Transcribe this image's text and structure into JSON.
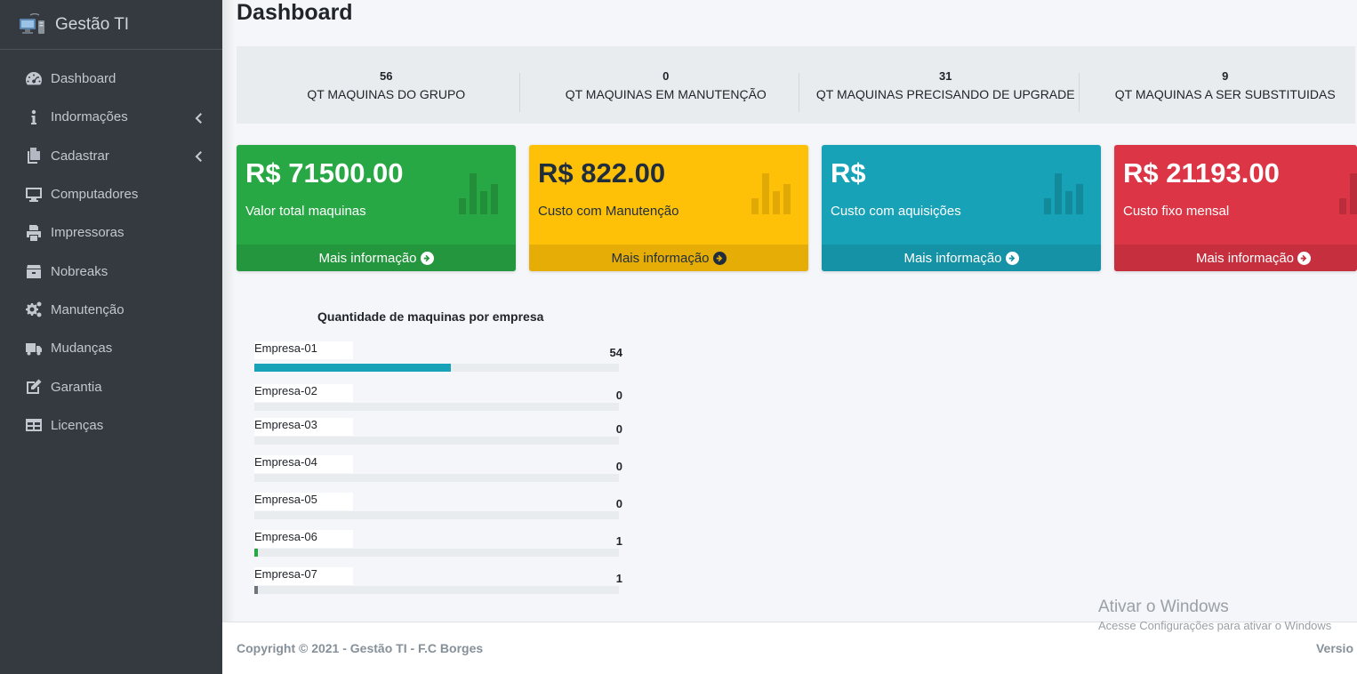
{
  "brand": {
    "name": "Gestão TI"
  },
  "sidebar": {
    "items": [
      {
        "label": "Dashboard",
        "icon": "tachometer-icon"
      },
      {
        "label": "Indormações",
        "icon": "info-icon",
        "has_submenu": true
      },
      {
        "label": "Cadastrar",
        "icon": "copy-icon",
        "has_submenu": true
      },
      {
        "label": "Computadores",
        "icon": "desktop-icon"
      },
      {
        "label": "Impressoras",
        "icon": "printer-icon"
      },
      {
        "label": "Nobreaks",
        "icon": "box-icon"
      },
      {
        "label": "Manutenção",
        "icon": "cogs-icon"
      },
      {
        "label": "Mudanças",
        "icon": "truck-icon"
      },
      {
        "label": "Garantia",
        "icon": "edit-icon"
      },
      {
        "label": "Licenças",
        "icon": "table-icon"
      }
    ]
  },
  "page": {
    "title": "Dashboard"
  },
  "stats": [
    {
      "value": "56",
      "label": "QT MAQUINAS DO GRUPO"
    },
    {
      "value": "0",
      "label": "QT MAQUINAS EM MANUTENÇÃO"
    },
    {
      "value": "31",
      "label": "QT MAQUINAS PRECISANDO DE UPGRADE"
    },
    {
      "value": "9",
      "label": "QT MAQUINAS A SER SUBSTITUIDAS"
    }
  ],
  "boxes": [
    {
      "value": "R$ 71500.00",
      "label": "Valor total maquinas",
      "footer": "Mais informação",
      "color": "#28a745"
    },
    {
      "value": "R$ 822.00",
      "label": "Custo com Manutenção",
      "footer": "Mais informação",
      "color": "#ffc107"
    },
    {
      "value": "R$",
      "label": "Custo com aquisições",
      "footer": "Mais informação",
      "color": "#17a2b8"
    },
    {
      "value": "R$ 21193.00",
      "label": "Custo fixo mensal",
      "footer": "Mais informação",
      "color": "#dc3545"
    }
  ],
  "chart_data": {
    "type": "bar",
    "title": "Quantidade de maquinas por empresa",
    "categories": [
      "Empresa-01",
      "Empresa-02",
      "Empresa-03",
      "Empresa-04",
      "Empresa-05",
      "Empresa-06",
      "Empresa-07"
    ],
    "values": [
      54,
      0,
      0,
      0,
      0,
      1,
      1
    ],
    "max": 100,
    "colors": [
      "#17a2b8",
      "#e9ecef",
      "#e9ecef",
      "#e9ecef",
      "#e9ecef",
      "#28a745",
      "#6c757d"
    ]
  },
  "footer": {
    "copyright": "Copyright © 2021 - Gestão TI - F.C Borges",
    "version": "Versio"
  },
  "watermark": {
    "line1": "Ativar o Windows",
    "line2": "Acesse Configurações para ativar o Windows"
  }
}
